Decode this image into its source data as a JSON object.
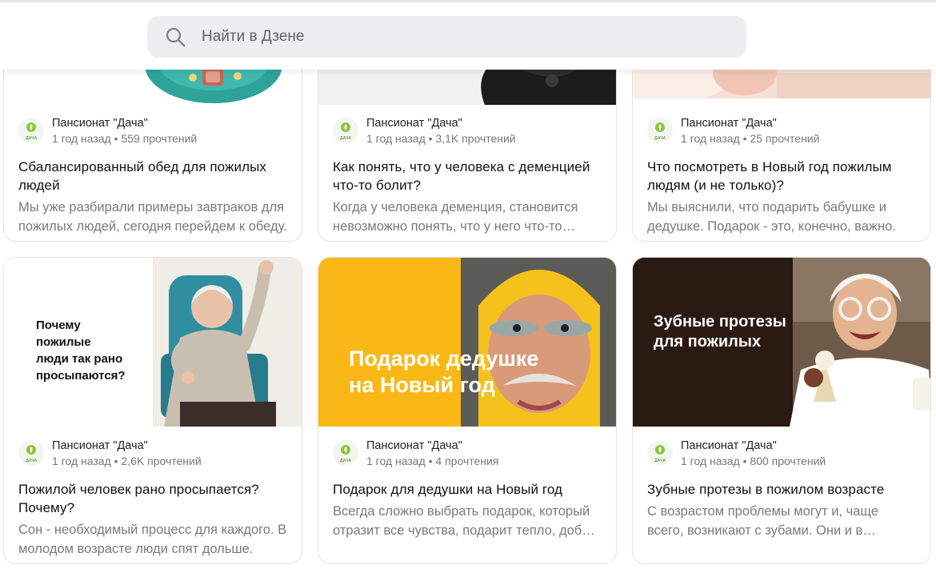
{
  "search": {
    "placeholder": "Найти в Дзене",
    "icon": "search-icon"
  },
  "avatar": {
    "caption": "ДАЧА",
    "icon": "leaf-logo-icon"
  },
  "cards": [
    {
      "channel": "Пансионат \"Дача\"",
      "meta": "1 год назад • 559 прочтений",
      "title": "Сбалансированный обед для пожилых людей",
      "snippet": "Мы уже разбирали примеры завтраков для пожилых людей, сегодня перейдем к обеду."
    },
    {
      "channel": "Пансионат \"Дача\"",
      "meta": "1 год назад • 3,1K прочтений",
      "title": "Как понять, что у человека с деменцией что-то болит?",
      "snippet": "Когда у человека деменция, становится невозможно понять, что у него что-то болит."
    },
    {
      "channel": "Пансионат \"Дача\"",
      "meta": "1 год назад • 25 прочтений",
      "title": "Что посмотреть в Новый год пожилым людям (и не только)?",
      "snippet": "Мы выяснили, что подарить бабушке и дедушке. Подарок - это, конечно, важно."
    },
    {
      "channel": "Пансионат \"Дача\"",
      "meta": "1 год назад • 2,6K прочтений",
      "title": "Пожилой человек рано просыпается? Почему?",
      "snippet": "Сон - необходимый процесс для каждого. В молодом возрасте люди спят дольше.",
      "image_text": [
        "Почему",
        "пожилые",
        "люди так рано",
        "просыпаются?"
      ]
    },
    {
      "channel": "Пансионат \"Дача\"",
      "meta": "1 год назад • 4 прочтения",
      "title": "Подарок для дедушки на Новый год",
      "snippet": "Всегда сложно выбрать подарок, который отразит все чувства, подарит тепло, добро и счастье человеку.",
      "image_text": [
        "Подарок дедушке",
        "на Новый год"
      ]
    },
    {
      "channel": "Пансионат \"Дача\"",
      "meta": "1 год назад • 800 прочтений",
      "title": "Зубные протезы в пожилом возрасте",
      "snippet": "С возрастом проблемы могут и, чаще всего, возникают с зубами. Они и в молодости покоя не дают - болят, крошатся.",
      "image_text": [
        "Зубные протезы",
        "для пожилых"
      ]
    }
  ],
  "colors": {
    "accent_yellow": "#f9b815",
    "dark_brown": "#2b1a12",
    "teal": "#2f9d94"
  }
}
